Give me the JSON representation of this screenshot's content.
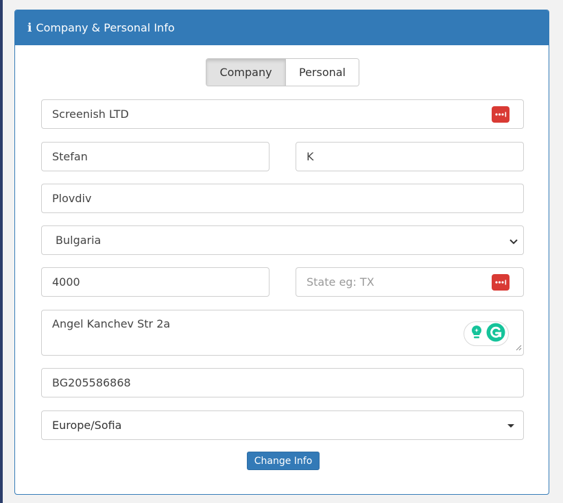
{
  "panel": {
    "title": "Company & Personal Info"
  },
  "tabs": {
    "company": "Company",
    "personal": "Personal"
  },
  "form": {
    "company_name": "Screenish LTD",
    "first_name": "Stefan",
    "last_name": "K",
    "city": "Plovdiv",
    "country": "Bulgaria",
    "zip": "4000",
    "state_placeholder": "State eg: TX",
    "address": "Angel Kanchev Str 2a",
    "vat": "BG205586868",
    "timezone": "Europe/Sofia"
  },
  "actions": {
    "change_info": "Change Info"
  },
  "colors": {
    "primary": "#337ab7",
    "password_icon": "#d93a34",
    "grammarly_green": "#15c39a"
  },
  "icons": [
    "info-icon",
    "password-manager-icon",
    "chevron-down-icon",
    "caret-down-icon",
    "grammarly-icon",
    "lightbulb-icon"
  ]
}
